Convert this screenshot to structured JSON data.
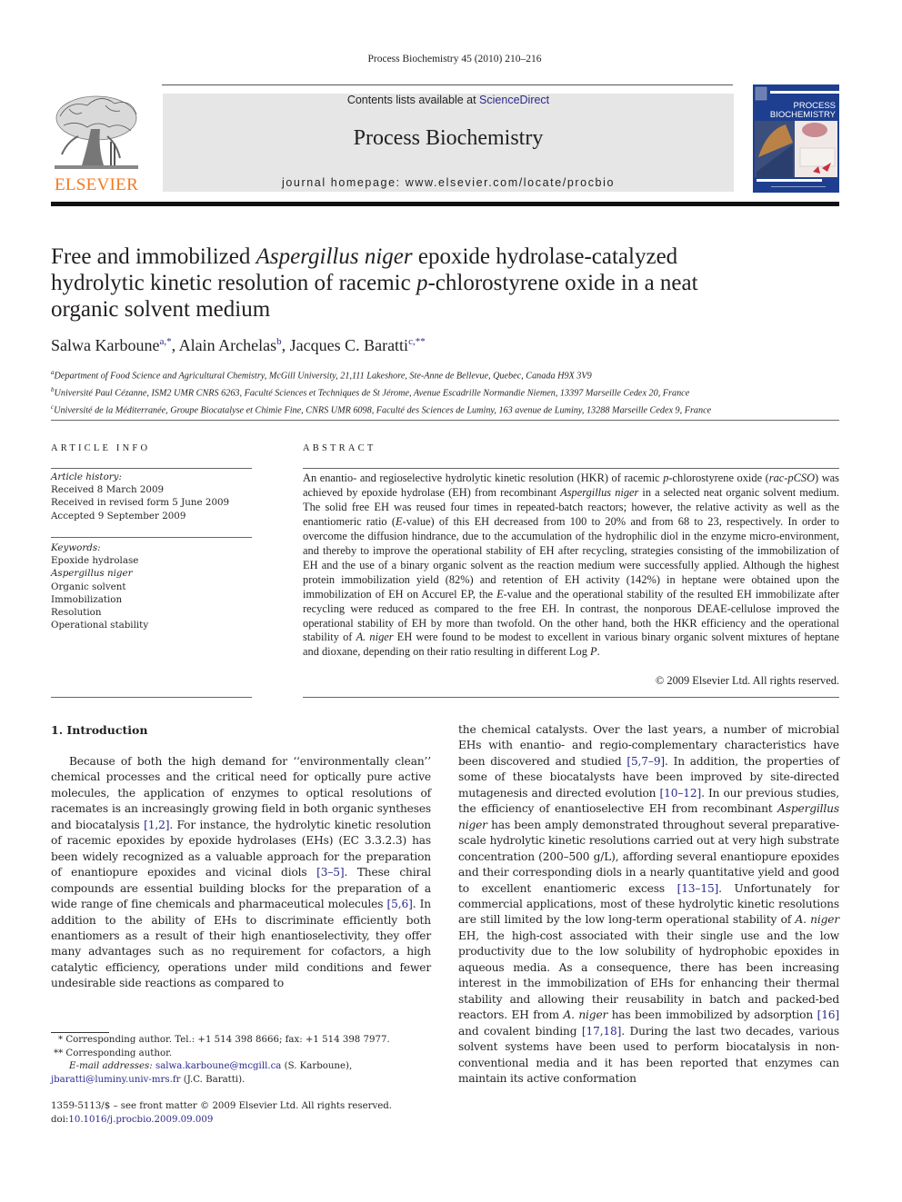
{
  "header": {
    "journal_ref": "Process Biochemistry 45 (2010) 210–216",
    "contents_prefix": "Contents lists available at ",
    "contents_link": "ScienceDirect",
    "journal_title": "Process Biochemistry",
    "homepage": "journal homepage: www.elsevier.com/locate/procbio",
    "publisher_logo_text": "ELSEVIER",
    "cover_title_line1": "PROCESS",
    "cover_title_line2": "BIOCHEMISTRY",
    "colors": {
      "publisher_orange": "#f47920",
      "link_blue": "#2a2a8c",
      "cover_blue": "#1e3f8f",
      "banner_gray": "#e6e6e6"
    }
  },
  "article": {
    "title_parts": {
      "t1": "Free and immobilized ",
      "t2": "Aspergillus niger",
      "t3": " epoxide hydrolase-catalyzed",
      "t4": "hydrolytic kinetic resolution of racemic ",
      "t5": "p",
      "t6": "-chlorostyrene oxide in a neat",
      "t7": "organic solvent medium"
    },
    "authors": [
      {
        "name": "Salwa Karboune",
        "marks": "a,*"
      },
      {
        "name": "Alain Archelas",
        "marks": "b"
      },
      {
        "name": "Jacques C. Baratti",
        "marks": "c,**"
      }
    ],
    "affiliations": [
      {
        "mark": "a",
        "text": "Department of Food Science and Agricultural Chemistry, McGill University, 21,111 Lakeshore, Ste-Anne de Bellevue, Quebec, Canada H9X 3V9"
      },
      {
        "mark": "b",
        "text": "Université Paul Cézanne, ISM2 UMR CNRS 6263, Faculté Sciences et Techniques de St Jérome, Avenue Escadrille Normandie Niemen, 13397 Marseille Cedex 20, France"
      },
      {
        "mark": "c",
        "text": "Université de la Méditerranée, Groupe Biocatalyse et Chimie Fine, CNRS UMR 6098, Faculté des Sciences de Luminy, 163 avenue de Luminy, 13288 Marseille Cedex 9, France"
      }
    ]
  },
  "article_info": {
    "heading": "ARTICLE INFO",
    "history_label": "Article history:",
    "history": [
      "Received 8 March 2009",
      "Received in revised form 5 June 2009",
      "Accepted 9 September 2009"
    ],
    "keywords_label": "Keywords:",
    "keywords": [
      "Epoxide hydrolase",
      "Aspergillus niger",
      "Organic solvent",
      "Immobilization",
      "Resolution",
      "Operational stability"
    ]
  },
  "abstract": {
    "heading": "ABSTRACT",
    "p1": "An enantio- and regioselective hydrolytic kinetic resolution (HKR) of racemic ",
    "p1_i1": "p",
    "p2": "-chlorostyrene oxide (",
    "p2_i": "rac-pCSO",
    "p3": ") was achieved by epoxide hydrolase (EH) from recombinant ",
    "p3_i": "Aspergillus niger",
    "p4": " in a selected neat organic solvent medium. The solid free EH was reused four times in repeated-batch reactors; however, the relative activity as well as the enantiomeric ratio (",
    "p4_i": "E",
    "p5": "-value) of this EH decreased from 100 to 20% and from 68 to 23, respectively. In order to overcome the diffusion hindrance, due to the accumulation of the hydrophilic diol in the enzyme micro-environment, and thereby to improve the operational stability of EH after recycling, strategies consisting of the immobilization of EH and the use of a binary organic solvent as the reaction medium were successfully applied. Although the highest protein immobilization yield (82%) and retention of EH activity (142%) in heptane were obtained upon the immobilization of EH on Accurel EP, the ",
    "p5_i": "E",
    "p6": "-value and the operational stability of the resulted EH immobilizate after recycling were reduced as compared to the free EH. In contrast, the nonporous DEAE-cellulose improved the operational stability of EH by more than twofold. On the other hand, both the HKR efficiency and the operational stability of ",
    "p6_i": "A. niger",
    "p7": " EH were found to be modest to excellent in various binary organic solvent mixtures of heptane and dioxane, depending on their ratio resulting in different Log ",
    "p7_i": "P",
    "p8": ".",
    "copyright": "© 2009 Elsevier Ltd. All rights reserved."
  },
  "introduction": {
    "heading": "1.  Introduction",
    "col1": {
      "a": "Because of both the high demand for ‘‘environmentally clean’’ chemical processes and the critical need for optically pure active molecules, the application of enzymes to optical resolutions of racemates is an increasingly growing field in both organic syntheses and biocatalysis ",
      "r1": "[1,2]",
      "b": ". For instance, the hydrolytic kinetic resolution of racemic epoxides by epoxide hydrolases (EHs) (EC 3.3.2.3) has been widely recognized as a valuable approach for the preparation of enantiopure epoxides and vicinal diols ",
      "r2": "[3–5]",
      "c": ". These chiral compounds are essential building blocks for the preparation of a wide range of fine chemicals and pharmaceutical molecules ",
      "r3": "[5,6]",
      "d": ". In addition to the ability of EHs to discriminate efficiently both enantiomers as a result of their high enantioselectivity, they offer many advantages such as no requirement for cofactors, a high catalytic efficiency, operations under mild conditions and fewer undesirable side reactions as compared to"
    },
    "col2": {
      "a": "the chemical catalysts. Over the last years, a number of microbial EHs with enantio- and regio-complementary characteristics have been discovered and studied ",
      "r1": "[5,7–9]",
      "b": ". In addition, the properties of some of these biocatalysts have been improved by site-directed mutagenesis and directed evolution ",
      "r2": "[10–12]",
      "c": ". In our previous studies, the efficiency of enantioselective EH from recombinant ",
      "c_i": "Aspergillus niger",
      "d": " has been amply demonstrated throughout several preparative-scale hydrolytic kinetic resolutions carried out at very high substrate concentration (200–500 g/L), affording several enantiopure epoxides and their corresponding diols in a nearly quantitative yield and good to excellent enantiomeric excess ",
      "r3": "[13–15]",
      "e": ". Unfortunately for commercial applications, most of these hydrolytic kinetic resolutions are still limited by the low long-term operational stability of ",
      "e_i": "A. niger",
      "f": " EH, the high-cost associated with their single use and the low productivity due to the low solubility of hydrophobic epoxides in aqueous media. As a consequence, there has been increasing interest in the immobilization of EHs for enhancing their thermal stability and allowing their reusability in batch and packed-bed reactors. EH from ",
      "f_i": "A. niger",
      "g": " has been immobilized by adsorption ",
      "r4": "[16]",
      "h": " and covalent binding ",
      "r5": "[17,18]",
      "i": ". During the last two decades, various solvent systems have been used to perform biocatalysis in non-conventional media and it has been reported that enzymes can maintain its active conformation"
    }
  },
  "footnotes": {
    "fn1": "* Corresponding author. Tel.: +1 514 398 8666; fax: +1 514 398 7977.",
    "fn2": "** Corresponding author.",
    "email_label": "E-mail addresses: ",
    "email1": "salwa.karboune@mcgill.ca",
    "email1_who": " (S. Karboune),",
    "email2": "jbaratti@luminy.univ-mrs.fr",
    "email2_who": " (J.C. Baratti).",
    "front_matter": "1359-5113/$ – see front matter © 2009 Elsevier Ltd. All rights reserved.",
    "doi_label": "doi:",
    "doi": "10.1016/j.procbio.2009.09.009"
  }
}
